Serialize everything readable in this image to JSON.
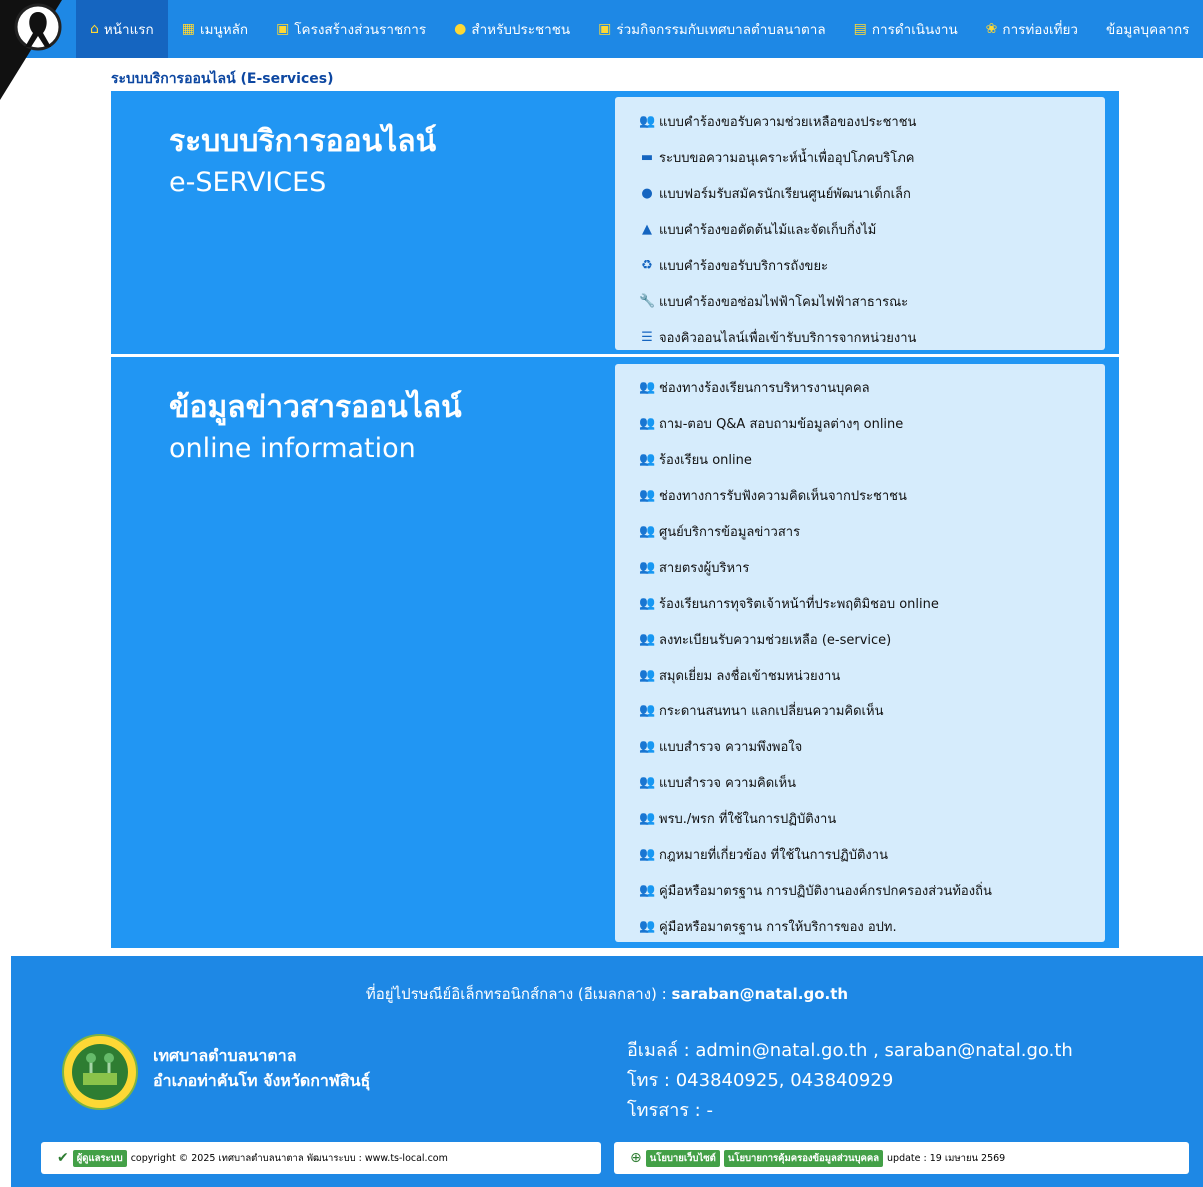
{
  "nav": {
    "items": [
      {
        "label": "หน้าแรก",
        "icon": "home-icon",
        "glyph": "⌂"
      },
      {
        "label": "เมนูหลัก",
        "icon": "grid-icon",
        "glyph": "▦"
      },
      {
        "label": "โครงสร้างส่วนราชการ",
        "icon": "calendar-icon",
        "glyph": "▣"
      },
      {
        "label": "สำหรับประชาชน",
        "icon": "user-circle-icon",
        "glyph": "●"
      },
      {
        "label": "ร่วมกิจกรรมกับเทศบาลตำบลนาตาล",
        "icon": "calendar-icon",
        "glyph": "▣"
      },
      {
        "label": "การดำเนินงาน",
        "icon": "document-icon",
        "glyph": "▤"
      },
      {
        "label": "การท่องเที่ยว",
        "icon": "flower-icon",
        "glyph": "❀"
      },
      {
        "label": "ข้อมูลบุคลากร",
        "icon": "",
        "glyph": ""
      }
    ]
  },
  "section_title": "ระบบบริการออนไลน์ (E-services)",
  "eservices": {
    "title_th": "ระบบบริการออนไลน์",
    "title_en": "e-SERVICES",
    "links": [
      {
        "label": "แบบคำร้องขอรับความช่วยเหลือของประชาชน",
        "icon": "users-icon",
        "glyph": "👥",
        "color": "#1565c0"
      },
      {
        "label": "ระบบขอความอนุเคราะห์น้ำเพื่ออุปโภคบริโภค",
        "icon": "id-card-icon",
        "glyph": "▬",
        "color": "#1565c0"
      },
      {
        "label": "แบบฟอร์มรับสมัครนักเรียนศูนย์พัฒนาเด็กเล็ก",
        "icon": "comment-icon",
        "glyph": "●",
        "color": "#1565c0"
      },
      {
        "label": "แบบคำร้องขอตัดต้นไม้และจัดเก็บกิ่งไม้",
        "icon": "tree-icon",
        "glyph": "▲",
        "color": "#1565c0"
      },
      {
        "label": "แบบคำร้องขอรับบริการถังขยะ",
        "icon": "recycle-icon",
        "glyph": "♻",
        "color": "#1565c0"
      },
      {
        "label": "แบบคำร้องขอซ่อมไฟฟ้าโคมไฟฟ้าสาธารณะ",
        "icon": "wrench-icon",
        "glyph": "🔧",
        "color": "#1565c0"
      },
      {
        "label": "จองคิวออนไลน์เพื่อเข้ารับบริการจากหน่วยงาน",
        "icon": "list-icon",
        "glyph": "☰",
        "color": "#1565c0"
      }
    ]
  },
  "info": {
    "title_th": "ข้อมูลข่าวสารออนไลน์",
    "title_en": "online information",
    "links": [
      {
        "label": "ช่องทางร้องเรียนการบริหารงานบุคคล"
      },
      {
        "label": "ถาม-ตอบ Q&A สอบถามข้อมูลต่างๆ online"
      },
      {
        "label": "ร้องเรียน online"
      },
      {
        "label": "ช่องทางการรับฟังความคิดเห็นจากประชาชน"
      },
      {
        "label": "ศูนย์บริการข้อมูลข่าวสาร"
      },
      {
        "label": "สายตรงผู้บริหาร"
      },
      {
        "label": "ร้องเรียนการทุจริตเจ้าหน้าที่ประพฤติมิชอบ online"
      },
      {
        "label": "ลงทะเบียนรับความช่วยเหลือ (e-service)"
      },
      {
        "label": "สมุดเยี่ยม ลงชื่อเข้าชมหน่วยงาน"
      },
      {
        "label": "กระดานสนทนา แลกเปลี่ยนความคิดเห็น"
      },
      {
        "label": "แบบสำรวจ ความพึงพอใจ"
      },
      {
        "label": "แบบสำรวจ ความคิดเห็น"
      },
      {
        "label": "พรบ./พรก ที่ใช้ในการปฏิบัติงาน"
      },
      {
        "label": "กฎหมายที่เกี่ยวข้อง ที่ใช้ในการปฏิบัติงาน"
      },
      {
        "label": "คู่มือหรือมาตรฐาน การปฏิบัติงานองค์กรปกครองส่วนท้องถิ่น"
      },
      {
        "label": "คู่มือหรือมาตรฐาน การให้บริการของ อปท."
      }
    ],
    "icon": "users-icon",
    "icon_color": "#2e7d32"
  },
  "footer": {
    "email_label": "ที่อยู่ไปรษณีย์อิเล็กทรอนิกส์กลาง (อีเมลกลาง) : ",
    "email_value": "saraban@natal.go.th",
    "org_line1": "เทศบาลตำบลนาตาล",
    "org_line2": "อำเภอท่าคันโท จังหวัดกาฬสินธุ์",
    "contact_email": "อีเมลล์ : admin@natal.go.th , saraban@natal.go.th",
    "contact_phone": "โทร : 043840925, 043840929",
    "contact_fax": "โทรสาร : -",
    "admin_badge": "ผู้ดูแลระบบ",
    "copyright": "copyright © 2025 เทศบาลตำบลนาตาล พัฒนาระบบ : www.ts-local.com",
    "policy_badge": "นโยบายเว็บไซต์",
    "privacy_badge": "นโยบายการคุ้มครองข้อมูลส่วนบุคคล",
    "update": "update : 19 เมษายน 2569"
  },
  "colors": {
    "nav": "#1e88e5",
    "panel": "#2196f3",
    "linkbox": "#d6ecfc",
    "badge": "#43a047"
  }
}
